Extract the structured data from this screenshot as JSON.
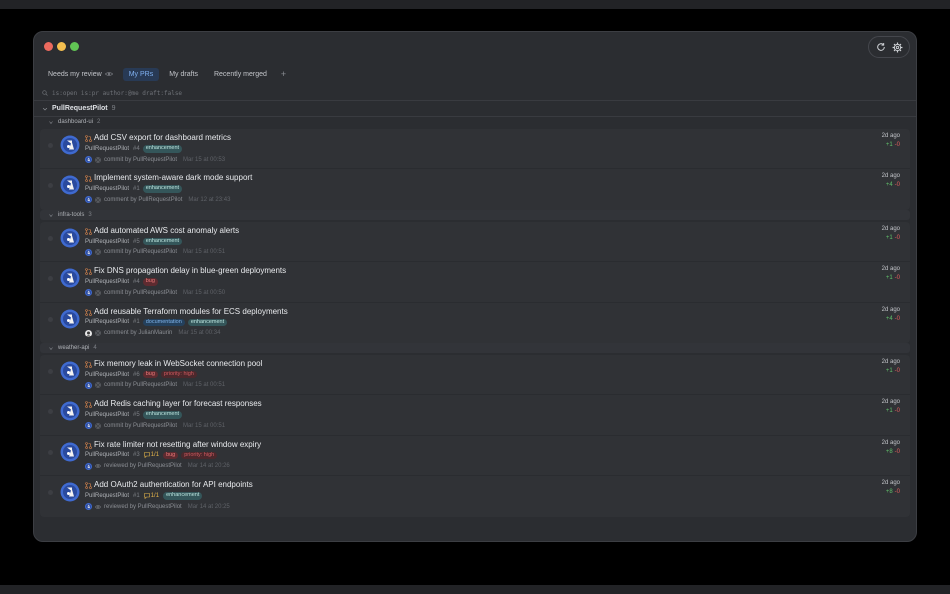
{
  "tabs": [
    {
      "label": "Needs my review",
      "active": false,
      "icon": "eye-icon"
    },
    {
      "label": "My PRs",
      "active": true
    },
    {
      "label": "My drafts",
      "active": false
    },
    {
      "label": "Recently merged",
      "active": false
    }
  ],
  "add_tab": "+",
  "search": {
    "value": "is:open is:pr author:@me draft:false"
  },
  "repo": {
    "name": "PullRequestPilot",
    "count": "9"
  },
  "groups": [
    {
      "name": "dashboard-ui",
      "count": "2",
      "prs": [
        {
          "title": "Add CSV export for dashboard metrics",
          "author": "PullRequestPilot",
          "number": "#4",
          "labels": [
            "enhancement"
          ],
          "activity_type": "commit",
          "activity_text": "commit by PullRequestPilot",
          "time": "Mar 15 at 00:53",
          "age": "2d ago",
          "add": "+1",
          "del": "-0"
        },
        {
          "title": "Implement system-aware dark mode support",
          "author": "PullRequestPilot",
          "number": "#1",
          "labels": [
            "enhancement"
          ],
          "activity_type": "comment",
          "activity_text": "comment by PullRequestPilot",
          "time": "Mar 12 at 23:43",
          "age": "2d ago",
          "add": "+4",
          "del": "-0"
        }
      ]
    },
    {
      "name": "infra-tools",
      "count": "3",
      "prs": [
        {
          "title": "Add automated AWS cost anomaly alerts",
          "author": "PullRequestPilot",
          "number": "#5",
          "labels": [
            "enhancement"
          ],
          "activity_type": "commit",
          "activity_text": "commit by PullRequestPilot",
          "time": "Mar 15 at 00:51",
          "age": "2d ago",
          "add": "+1",
          "del": "-0"
        },
        {
          "title": "Fix DNS propagation delay in blue-green deployments",
          "author": "PullRequestPilot",
          "number": "#4",
          "labels": [
            "bug"
          ],
          "activity_type": "commit",
          "activity_text": "commit by PullRequestPilot",
          "time": "Mar 15 at 00:50",
          "age": "2d ago",
          "add": "+1",
          "del": "-0"
        },
        {
          "title": "Add reusable Terraform modules for ECS deployments",
          "author": "PullRequestPilot",
          "number": "#1",
          "labels": [
            "documentation",
            "enhancement"
          ],
          "activity_type": "comment",
          "activity_text": "comment by JulianMaurin",
          "time": "Mar 15 at 00:34",
          "age": "2d ago",
          "add": "+4",
          "del": "-0",
          "human_avatar": true
        }
      ]
    },
    {
      "name": "weather-api",
      "count": "4",
      "prs": [
        {
          "title": "Fix memory leak in WebSocket connection pool",
          "author": "PullRequestPilot",
          "number": "#6",
          "labels": [
            "bug",
            "priority: high"
          ],
          "activity_type": "commit",
          "activity_text": "commit by PullRequestPilot",
          "time": "Mar 15 at 00:51",
          "age": "2d ago",
          "add": "+1",
          "del": "-0"
        },
        {
          "title": "Add Redis caching layer for forecast responses",
          "author": "PullRequestPilot",
          "number": "#5",
          "labels": [
            "enhancement"
          ],
          "activity_type": "commit",
          "activity_text": "commit by PullRequestPilot",
          "time": "Mar 15 at 00:51",
          "age": "2d ago",
          "add": "+1",
          "del": "-0"
        },
        {
          "title": "Fix rate limiter not resetting after window expiry",
          "author": "PullRequestPilot",
          "number": "#3",
          "conversations": "1/1",
          "labels": [
            "bug",
            "priority: high"
          ],
          "activity_type": "review",
          "activity_text": "reviewed by PullRequestPilot",
          "time": "Mar 14 at 20:26",
          "age": "2d ago",
          "add": "+8",
          "del": "-0"
        },
        {
          "title": "Add OAuth2 authentication for API endpoints",
          "author": "PullRequestPilot",
          "number": "#1",
          "conversations": "1/1",
          "labels": [
            "enhancement"
          ],
          "activity_type": "review",
          "activity_text": "reviewed by PullRequestPilot",
          "time": "Mar 14 at 20:25",
          "age": "2d ago",
          "add": "+8",
          "del": "-0"
        }
      ]
    }
  ],
  "colors": {
    "accent": "#7fb0f0",
    "add": "#5fbf6a",
    "del": "#e05d5d",
    "pr_icon": "#e38a4e"
  }
}
